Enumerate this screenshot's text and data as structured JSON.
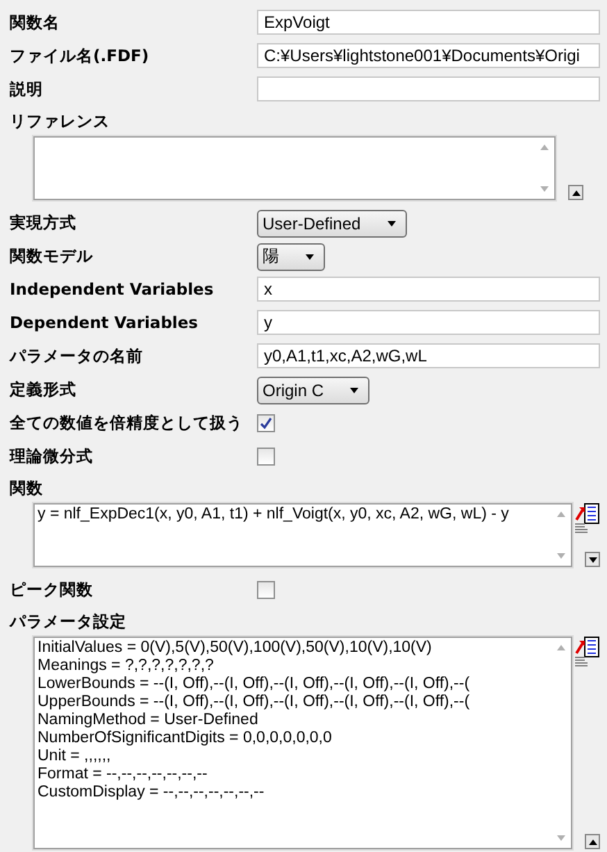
{
  "rows": [
    {
      "kind": "text",
      "label": "関数名",
      "value": "ExpVoigt"
    },
    {
      "kind": "text",
      "label": "ファイル名(.FDF)",
      "value": "C:¥Users¥lightstone001¥Documents¥Origi"
    },
    {
      "kind": "text",
      "label": "説明"
    },
    {
      "kind": "memo",
      "label": "リファレンス",
      "expanded": false
    },
    {
      "kind": "select",
      "label": "実現方式",
      "value": "User-Defined"
    },
    {
      "kind": "select",
      "label": "関数モデル",
      "value": "陽"
    },
    {
      "kind": "text",
      "label": "Independent Variables",
      "value": "x"
    },
    {
      "kind": "text",
      "label": "Dependent Variables",
      "value": "y"
    },
    {
      "kind": "text",
      "label": "パラメータの名前",
      "value": "y0,A1,t1,xc,A2,wG,wL"
    },
    {
      "kind": "select",
      "label": "定義形式",
      "value": "Origin C"
    },
    {
      "kind": "checkbox",
      "label": "全ての数値を倍精度として扱う",
      "checked": true
    },
    {
      "kind": "checkbox",
      "label": "理論微分式",
      "checked": false
    },
    {
      "kind": "code",
      "label": "関数",
      "expanded": true,
      "lines": [
        "y = nlf_ExpDec1(x, y0, A1, t1) + nlf_Voigt(x, y0, xc, A2, wG, wL) - y"
      ]
    },
    {
      "kind": "checkbox",
      "label": "ピーク関数",
      "checked": false
    },
    {
      "kind": "code",
      "label": "パラメータ設定",
      "expanded": false,
      "tall": true,
      "lines": [
        "InitialValues = 0(V),5(V),50(V),100(V),50(V),10(V),10(V)",
        "Meanings = ?,?,?,?,?,?,?",
        "LowerBounds = --(I, Off),--(I, Off),--(I, Off),--(I, Off),--(I, Off),--(",
        "UpperBounds = --(I, Off),--(I, Off),--(I, Off),--(I, Off),--(I, Off),--(",
        "NamingMethod = User-Defined",
        "NumberOfSignificantDigits = 0,0,0,0,0,0,0",
        "Unit = ,,,,,,",
        "Format = --,--,--,--,--,--,--",
        "CustomDisplay = --,--,--,--,--,--,--"
      ]
    }
  ]
}
